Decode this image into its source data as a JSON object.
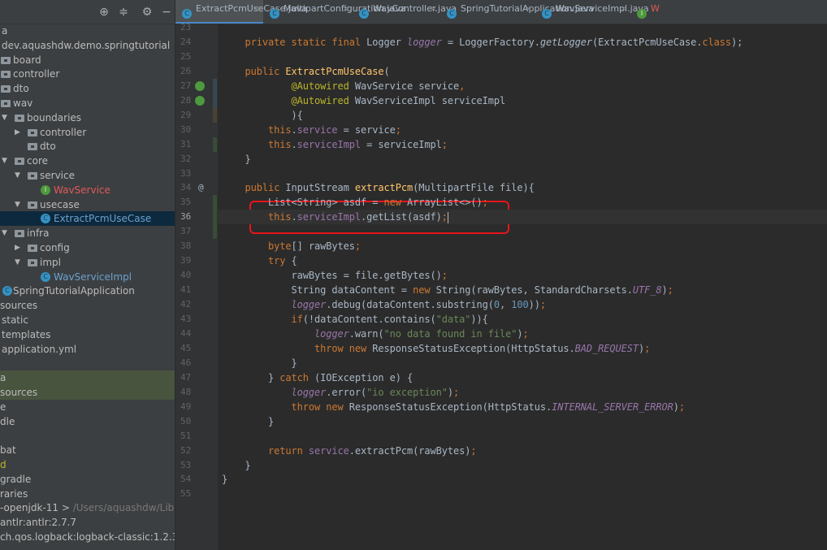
{
  "sidebar": {
    "toolbar_icons": [
      "locate-icon",
      "collapse-icon",
      "gear-icon",
      "minimize-icon"
    ],
    "items": [
      {
        "label": "a",
        "depth": -1,
        "type": "text"
      },
      {
        "label": "dev.aquashdw.demo.springtutorial",
        "depth": -1,
        "type": "text"
      },
      {
        "label": "board",
        "depth": 0,
        "type": "folder"
      },
      {
        "label": "controller",
        "depth": 0,
        "type": "folder"
      },
      {
        "label": "dto",
        "depth": 0,
        "type": "folder"
      },
      {
        "label": "wav",
        "depth": 0,
        "type": "folder"
      },
      {
        "label": "boundaries",
        "depth": 1,
        "type": "folder",
        "arrow": "down"
      },
      {
        "label": "controller",
        "depth": 2,
        "type": "folder",
        "arrow": "right"
      },
      {
        "label": "dto",
        "depth": 2,
        "type": "folder"
      },
      {
        "label": "core",
        "depth": 1,
        "type": "folder",
        "arrow": "down"
      },
      {
        "label": "service",
        "depth": 2,
        "type": "folder",
        "arrow": "down"
      },
      {
        "label": "WavService",
        "depth": 3,
        "type": "interface",
        "color": "#e0595a"
      },
      {
        "label": "usecase",
        "depth": 2,
        "type": "folder",
        "arrow": "down"
      },
      {
        "label": "ExtractPcmUseCase",
        "depth": 3,
        "type": "class",
        "color": "#6ca0cf",
        "selected": true
      },
      {
        "label": "infra",
        "depth": 1,
        "type": "folder",
        "arrow": "down"
      },
      {
        "label": "config",
        "depth": 2,
        "type": "folder",
        "arrow": "right"
      },
      {
        "label": "impl",
        "depth": 2,
        "type": "folder",
        "arrow": "down"
      },
      {
        "label": "WavServiceImpl",
        "depth": 3,
        "type": "class",
        "color": "#6ca0cf"
      },
      {
        "label": "SpringTutorialApplication",
        "depth": 0,
        "type": "spring"
      },
      {
        "label": "sources",
        "depth": -2,
        "type": "text"
      },
      {
        "label": "static",
        "depth": -1,
        "type": "text"
      },
      {
        "label": "templates",
        "depth": -1,
        "type": "text"
      },
      {
        "label": "application.yml",
        "depth": -1,
        "type": "text"
      },
      {
        "label": "",
        "depth": -2,
        "type": "text"
      },
      {
        "label": "a",
        "depth": -2,
        "type": "text",
        "green": true
      },
      {
        "label": "sources",
        "depth": -2,
        "type": "text",
        "green": true
      },
      {
        "label": "e",
        "depth": -2,
        "type": "text"
      },
      {
        "label": "dle",
        "depth": -2,
        "type": "text"
      },
      {
        "label": "",
        "depth": -2,
        "type": "text"
      },
      {
        "label": "bat",
        "depth": -2,
        "type": "text"
      },
      {
        "label": "d",
        "depth": -2,
        "type": "text",
        "color": "#bbb529"
      },
      {
        "label": "gradle",
        "depth": -2,
        "type": "text"
      },
      {
        "label": "raries",
        "depth": -2,
        "type": "text"
      },
      {
        "label": "-openjdk-11 >",
        "suffix": "/Users/aquashdw/Library/",
        "depth": -2,
        "type": "text"
      },
      {
        "label": "antlr:antlr:2.7.7",
        "depth": -2,
        "type": "text"
      },
      {
        "label": "ch.qos.logback:logback-classic:1.2.3",
        "depth": -2,
        "type": "text"
      }
    ]
  },
  "tabs": [
    {
      "label": "ExtractPcmUseCase.java",
      "icon": "C",
      "active": true
    },
    {
      "label": "MultipartConfiguration.java",
      "icon": "C"
    },
    {
      "label": "WavController.java",
      "icon": "C"
    },
    {
      "label": "SpringTutorialApplication.java",
      "icon": "C"
    },
    {
      "label": "WavServiceImpl.java",
      "icon": "C"
    },
    {
      "label": "W",
      "icon": "I",
      "color": "#e0595a"
    }
  ],
  "editor": {
    "first_line": 23,
    "current_line": 36,
    "lines": [
      [],
      [
        [
          "kw",
          "    private static final "
        ],
        [
          "",
          "Logger "
        ],
        [
          "fi",
          "logger"
        ],
        [
          "",
          " = LoggerFactory."
        ],
        [
          "it",
          "getLogger"
        ],
        [
          "",
          "(ExtractPcmUseCase."
        ],
        [
          "kw",
          "class"
        ],
        [
          "",
          ");"
        ]
      ],
      [],
      [
        [
          "kw",
          "    public "
        ],
        [
          "mth",
          "ExtractPcmUseCase"
        ],
        [
          "",
          "("
        ]
      ],
      [
        [
          "ann",
          "            @Autowired"
        ],
        [
          "",
          " WavService service"
        ],
        [
          "kw",
          ","
        ]
      ],
      [
        [
          "ann",
          "            @Autowired"
        ],
        [
          "",
          " WavServiceImpl serviceImpl"
        ]
      ],
      [
        [
          "",
          "            ){"
        ]
      ],
      [
        [
          "kw",
          "        this"
        ],
        [
          "",
          "."
        ],
        [
          "fld",
          "service"
        ],
        [
          "",
          " = service"
        ],
        [
          "kw",
          ";"
        ]
      ],
      [
        [
          "kw",
          "        this"
        ],
        [
          "",
          "."
        ],
        [
          "fld",
          "serviceImpl"
        ],
        [
          "",
          " = serviceImpl"
        ],
        [
          "kw",
          ";"
        ]
      ],
      [
        [
          "",
          "    }"
        ]
      ],
      [],
      [
        [
          "kw",
          "    public "
        ],
        [
          "",
          "InputStream "
        ],
        [
          "mth",
          "extractPcm"
        ],
        [
          "",
          "(MultipartFile file){"
        ]
      ],
      [
        [
          "",
          "        List<String> asdf = "
        ],
        [
          "kw",
          "new"
        ],
        [
          "",
          " ArrayList<>()"
        ],
        [
          "kw",
          ";"
        ]
      ],
      [
        [
          "kw",
          "        this"
        ],
        [
          "",
          "."
        ],
        [
          "fld",
          "serviceImpl"
        ],
        [
          "",
          ".getList(asdf)"
        ],
        [
          "kw",
          ";"
        ]
      ],
      [],
      [
        [
          "kw",
          "        byte"
        ],
        [
          "",
          "[] rawBytes"
        ],
        [
          "kw",
          ";"
        ]
      ],
      [
        [
          "kw",
          "        try"
        ],
        [
          "",
          " {"
        ]
      ],
      [
        [
          "",
          "            rawBytes = file.getBytes()"
        ],
        [
          "kw",
          ";"
        ]
      ],
      [
        [
          "",
          "            String dataContent = "
        ],
        [
          "kw",
          "new"
        ],
        [
          "",
          " String(rawBytes, StandardCharsets."
        ],
        [
          "fi",
          "UTF_8"
        ],
        [
          "",
          ")"
        ],
        [
          "kw",
          ";"
        ]
      ],
      [
        [
          "fi",
          "            logger"
        ],
        [
          "",
          ".debug(dataContent.substring("
        ],
        [
          "num",
          "0"
        ],
        [
          "",
          ", "
        ],
        [
          "num",
          "100"
        ],
        [
          "",
          "))"
        ],
        [
          "kw",
          ";"
        ]
      ],
      [
        [
          "kw",
          "            if"
        ],
        [
          "",
          "(!dataContent.contains("
        ],
        [
          "str",
          "\"data\""
        ],
        [
          "",
          ")){"
        ]
      ],
      [
        [
          "fi",
          "                logger"
        ],
        [
          "",
          ".warn("
        ],
        [
          "str",
          "\"no data found in file\""
        ],
        [
          "",
          ")"
        ],
        [
          "kw",
          ";"
        ]
      ],
      [
        [
          "kw",
          "                throw new "
        ],
        [
          "",
          "ResponseStatusException(HttpStatus."
        ],
        [
          "fi",
          "BAD_REQUEST"
        ],
        [
          "",
          ")"
        ],
        [
          "kw",
          ";"
        ]
      ],
      [
        [
          "",
          "            }"
        ]
      ],
      [
        [
          "",
          "        } "
        ],
        [
          "kw",
          "catch"
        ],
        [
          "",
          " (IOException e) {"
        ]
      ],
      [
        [
          "fi",
          "            logger"
        ],
        [
          "",
          ".error("
        ],
        [
          "str",
          "\"io exception\""
        ],
        [
          "",
          ")"
        ],
        [
          "kw",
          ";"
        ]
      ],
      [
        [
          "kw",
          "            throw new "
        ],
        [
          "",
          "ResponseStatusException(HttpStatus."
        ],
        [
          "fi",
          "INTERNAL_SERVER_ERROR"
        ],
        [
          "",
          ")"
        ],
        [
          "kw",
          ";"
        ]
      ],
      [
        [
          "",
          "        }"
        ]
      ],
      [],
      [
        [
          "kw",
          "        return "
        ],
        [
          "fld",
          "service"
        ],
        [
          "",
          ".extractPcm(rawBytes)"
        ],
        [
          "kw",
          ";"
        ]
      ],
      [
        [
          "",
          "    }"
        ]
      ],
      [
        [
          "",
          "}"
        ]
      ],
      []
    ]
  },
  "colors": {
    "highlight_box": "#e8141a",
    "keyword": "#cc7832",
    "string": "#6a8759",
    "field": "#9876aa"
  }
}
